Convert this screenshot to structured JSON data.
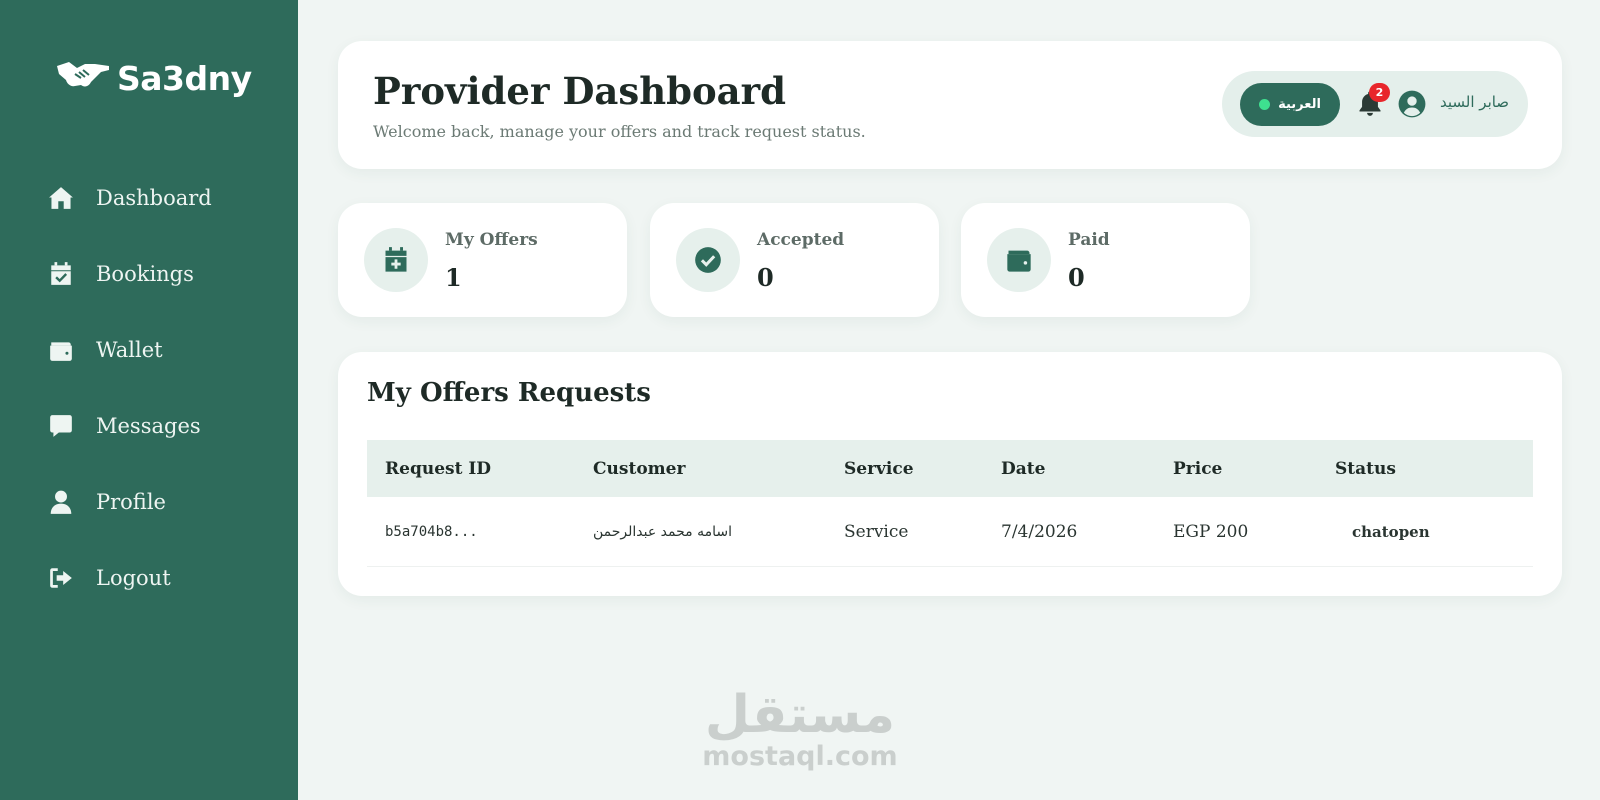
{
  "brand": {
    "name": "Sa3dny",
    "logo_icon": "handshake-icon"
  },
  "sidebar": {
    "items": [
      {
        "label": "Dashboard",
        "icon": "home-icon"
      },
      {
        "label": "Bookings",
        "icon": "calendar-check-icon"
      },
      {
        "label": "Wallet",
        "icon": "wallet-icon"
      },
      {
        "label": "Messages",
        "icon": "message-icon"
      },
      {
        "label": "Profile",
        "icon": "user-icon"
      },
      {
        "label": "Logout",
        "icon": "logout-icon"
      }
    ]
  },
  "header": {
    "title": "Provider Dashboard",
    "subtitle": "Welcome back, manage your offers and track request status.",
    "language_button": "العربية",
    "notification_count": "2",
    "user_name": "صابر السيد"
  },
  "stats": [
    {
      "label": "My Offers",
      "value": "1",
      "icon": "calendar-plus-icon"
    },
    {
      "label": "Accepted",
      "value": "0",
      "icon": "check-circle-icon"
    },
    {
      "label": "Paid",
      "value": "0",
      "icon": "wallet-icon"
    }
  ],
  "requests": {
    "title": "My Offers Requests",
    "columns": [
      "Request ID",
      "Customer",
      "Service",
      "Date",
      "Price",
      "Status"
    ],
    "rows": [
      {
        "request_id": "b5a704b8...",
        "customer": "اسامه محمد عبدالرحمن",
        "service": "Service",
        "date": "7/4/2026",
        "price": "EGP 200",
        "status": "chatopen"
      }
    ]
  },
  "watermark": {
    "arabic": "مستقل",
    "english": "mostaql.com"
  },
  "colors": {
    "primary": "#2e6b5b",
    "background": "#f0f5f3",
    "badge": "#e8262b",
    "online_dot": "#3ee08f"
  }
}
